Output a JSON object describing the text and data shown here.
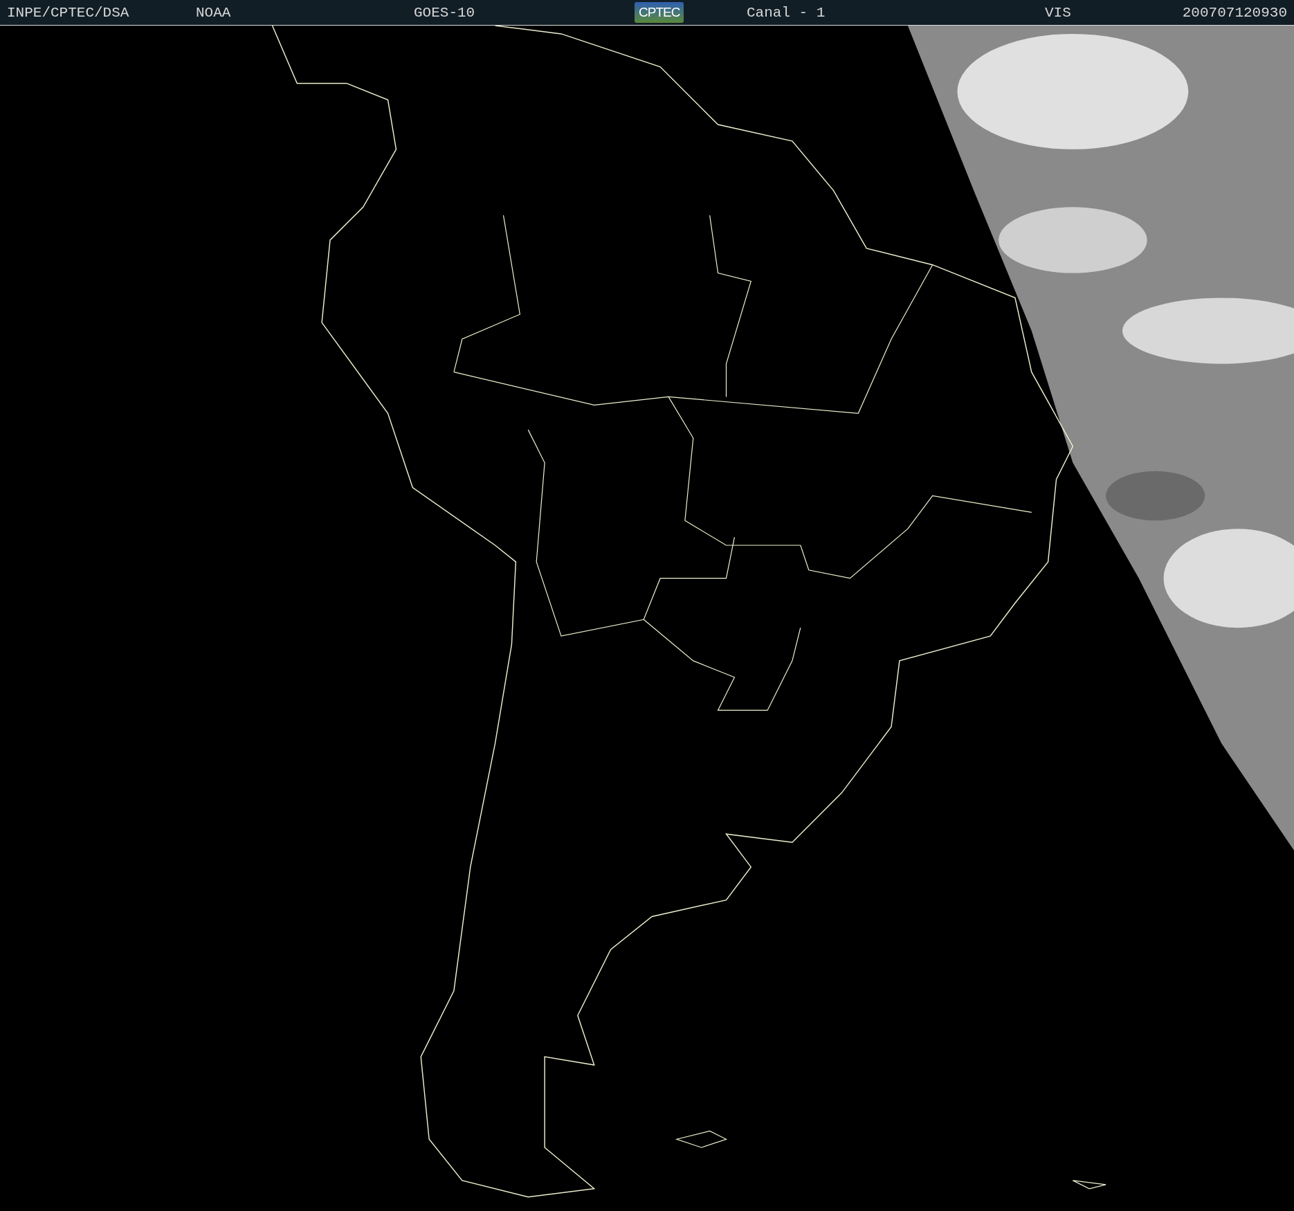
{
  "header": {
    "items": [
      {
        "kind": "text",
        "text": "INPE/CPTEC/DSA"
      },
      {
        "kind": "text",
        "text": "NOAA"
      },
      {
        "kind": "text",
        "text": "GOES-10"
      },
      {
        "kind": "logo",
        "text": "CPTEC"
      },
      {
        "kind": "text",
        "text": "Canal - 1"
      },
      {
        "kind": "text",
        "text": "VIS"
      },
      {
        "kind": "text",
        "text": "200707120930"
      }
    ]
  }
}
